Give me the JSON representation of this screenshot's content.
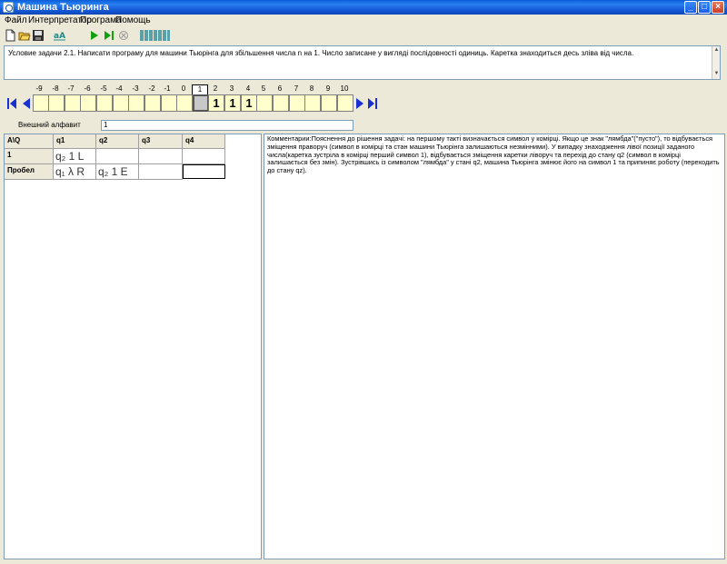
{
  "window": {
    "title": "Машина Тьюринга",
    "minimize": "_",
    "maximize": "□",
    "close": "×"
  },
  "menu": [
    "Файл",
    "Интерпретатор",
    "Програма",
    "Помощь"
  ],
  "toolbar": {
    "icons": [
      "new-file-icon",
      "open-folder-icon",
      "save-icon",
      "alphabet-icon",
      "run-icon",
      "step-icon",
      "stop-icon",
      "speed-bars-icon"
    ]
  },
  "task": {
    "text": "Условие задачи 2.1. Написати програму для машини Тьюрінга для збільшення числа n на 1. Число записане у вигляді послідовності одиниць. Каретка знаходиться десь зліва від числа."
  },
  "tape": {
    "positions": [
      "-9",
      "-8",
      "-7",
      "-6",
      "-5",
      "-4",
      "-3",
      "-2",
      "-1",
      "0",
      "1",
      "2",
      "3",
      "4",
      "5",
      "6",
      "7",
      "8",
      "9",
      "10"
    ],
    "cells": [
      "",
      "",
      "",
      "",
      "",
      "",
      "",
      "",
      "",
      "",
      "",
      "1",
      "1",
      "1",
      "",
      "",
      "",
      "",
      "",
      ""
    ],
    "current_index": 10
  },
  "alphabet": {
    "label": "Внешний алфавит",
    "value": "1"
  },
  "program_table": {
    "corner": "A\\Q",
    "states": [
      "q1",
      "q2",
      "q3",
      "q4"
    ],
    "rows": [
      {
        "symbol": "1",
        "cells": [
          "q₂  1  L",
          "",
          "",
          ""
        ]
      },
      {
        "symbol": "Пробел",
        "cells": [
          "q₁  λ  R",
          "q₂  1  E",
          "",
          ""
        ]
      }
    ]
  },
  "comment": {
    "text": "Комментарии:Пояснення до рішення задачі: на першому такті визначається символ у комірці. Якщо це знак \"лямбда\"(\"пусто\"), то відбувається зміщення праворуч (символ в комірці та стан машини Тьюрінга залишаються незмінними). У випадку знаходження лівої позиції заданого числа(каретка зустріла в комірці перший символ 1), відбувається зміщення каретки ліворуч та перехід до стану q2 (символ в комірці залишається без змін). Зустрівшись із символом \"лямбда\" у стані q2, машина Тьюрінга змінює його на символ 1 та припиняє роботу (переходить до стану  qz)."
  },
  "colors": {
    "titlebar": "#1558d6",
    "tape_cell": "#ffffcc",
    "tape_current": "#c8c8c8",
    "nav_arrow": "#1a2fd0",
    "run_green": "#10a010",
    "speed_bars": "#5aa0a8"
  }
}
